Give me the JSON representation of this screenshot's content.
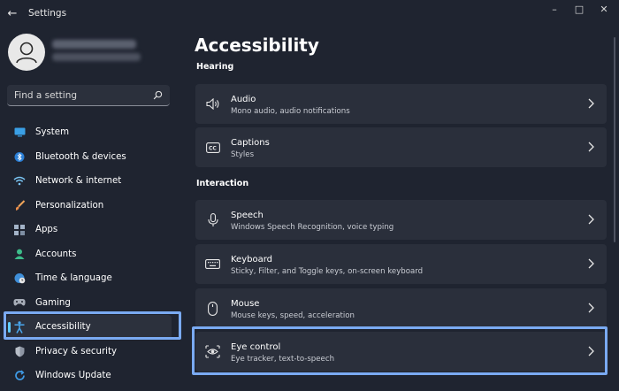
{
  "app": {
    "title": "Settings"
  },
  "search": {
    "placeholder": "Find a setting"
  },
  "sidebar": {
    "items": [
      {
        "label": "System",
        "icon": "monitor-icon"
      },
      {
        "label": "Bluetooth & devices",
        "icon": "bluetooth-icon"
      },
      {
        "label": "Network & internet",
        "icon": "wifi-icon"
      },
      {
        "label": "Personalization",
        "icon": "brush-icon"
      },
      {
        "label": "Apps",
        "icon": "apps-icon"
      },
      {
        "label": "Accounts",
        "icon": "person-icon"
      },
      {
        "label": "Time & language",
        "icon": "globe-clock-icon"
      },
      {
        "label": "Gaming",
        "icon": "gamepad-icon"
      },
      {
        "label": "Accessibility",
        "icon": "accessibility-icon",
        "selected": true
      },
      {
        "label": "Privacy & security",
        "icon": "shield-icon"
      },
      {
        "label": "Windows Update",
        "icon": "update-icon"
      }
    ]
  },
  "main": {
    "title": "Accessibility",
    "sections": [
      {
        "label": "Hearing",
        "cards": [
          {
            "title": "Audio",
            "subtitle": "Mono audio, audio notifications",
            "icon": "speaker-icon"
          },
          {
            "title": "Captions",
            "subtitle": "Styles",
            "icon": "captions-icon"
          }
        ]
      },
      {
        "label": "Interaction",
        "cards": [
          {
            "title": "Speech",
            "subtitle": "Windows Speech Recognition, voice typing",
            "icon": "microphone-icon"
          },
          {
            "title": "Keyboard",
            "subtitle": "Sticky, Filter, and Toggle keys, on-screen keyboard",
            "icon": "keyboard-icon"
          },
          {
            "title": "Mouse",
            "subtitle": "Mouse keys, speed, acceleration",
            "icon": "mouse-icon"
          },
          {
            "title": "Eye control",
            "subtitle": "Eye tracker, text-to-speech",
            "icon": "eye-control-icon"
          }
        ]
      }
    ]
  },
  "colors": {
    "background": "#1f2430",
    "card": "#2a2f3b",
    "accent": "#60cdff",
    "highlight": "#7aaaf2"
  }
}
